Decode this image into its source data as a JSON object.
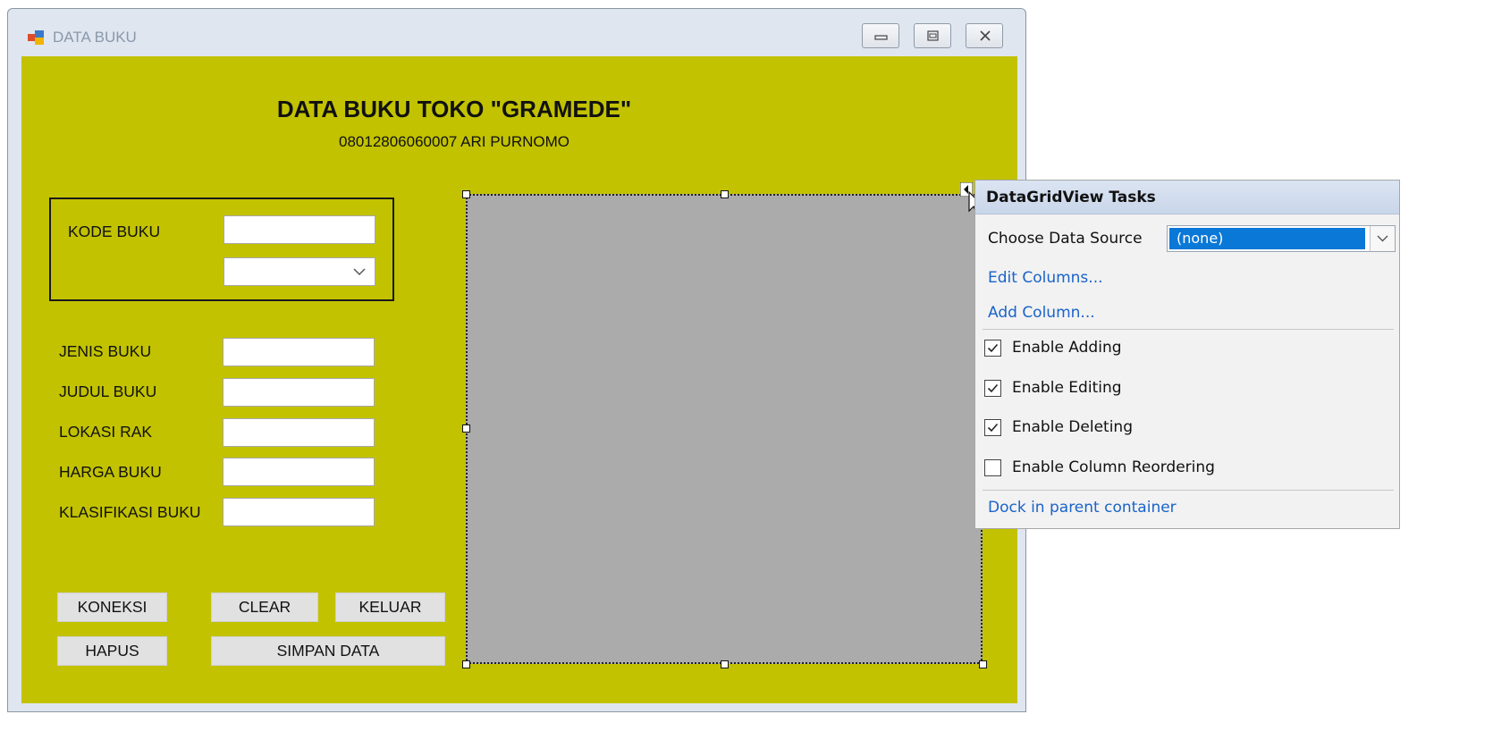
{
  "window": {
    "title": "DATA BUKU"
  },
  "form": {
    "heading": "DATA BUKU TOKO \"GRAMEDE\"",
    "subheading": "08012806060007  ARI PURNOMO",
    "kode_buku_label": "KODE BUKU",
    "kode_buku_value": "",
    "kode_combo_value": "",
    "fields": [
      {
        "label": "JENIS BUKU",
        "value": ""
      },
      {
        "label": "JUDUL BUKU",
        "value": ""
      },
      {
        "label": "LOKASI RAK",
        "value": ""
      },
      {
        "label": "HARGA BUKU",
        "value": ""
      },
      {
        "label": "KLASIFIKASI BUKU",
        "value": ""
      }
    ],
    "buttons": {
      "koneksi": "KONEKSI",
      "clear": "CLEAR",
      "keluar": "KELUAR",
      "hapus": "HAPUS",
      "simpan": "SIMPAN DATA"
    },
    "colors": {
      "form_background": "#c2c200",
      "grid_background": "#ababab"
    }
  },
  "tasks_panel": {
    "title": "DataGridView Tasks",
    "data_source_label": "Choose Data Source",
    "data_source_value": "(none)",
    "edit_columns": "Edit Columns...",
    "add_column": "Add Column...",
    "options": [
      {
        "label": "Enable Adding",
        "checked": true
      },
      {
        "label": "Enable Editing",
        "checked": true
      },
      {
        "label": "Enable Deleting",
        "checked": true
      },
      {
        "label": "Enable Column Reordering",
        "checked": false
      }
    ],
    "dock_link": "Dock in parent container"
  }
}
